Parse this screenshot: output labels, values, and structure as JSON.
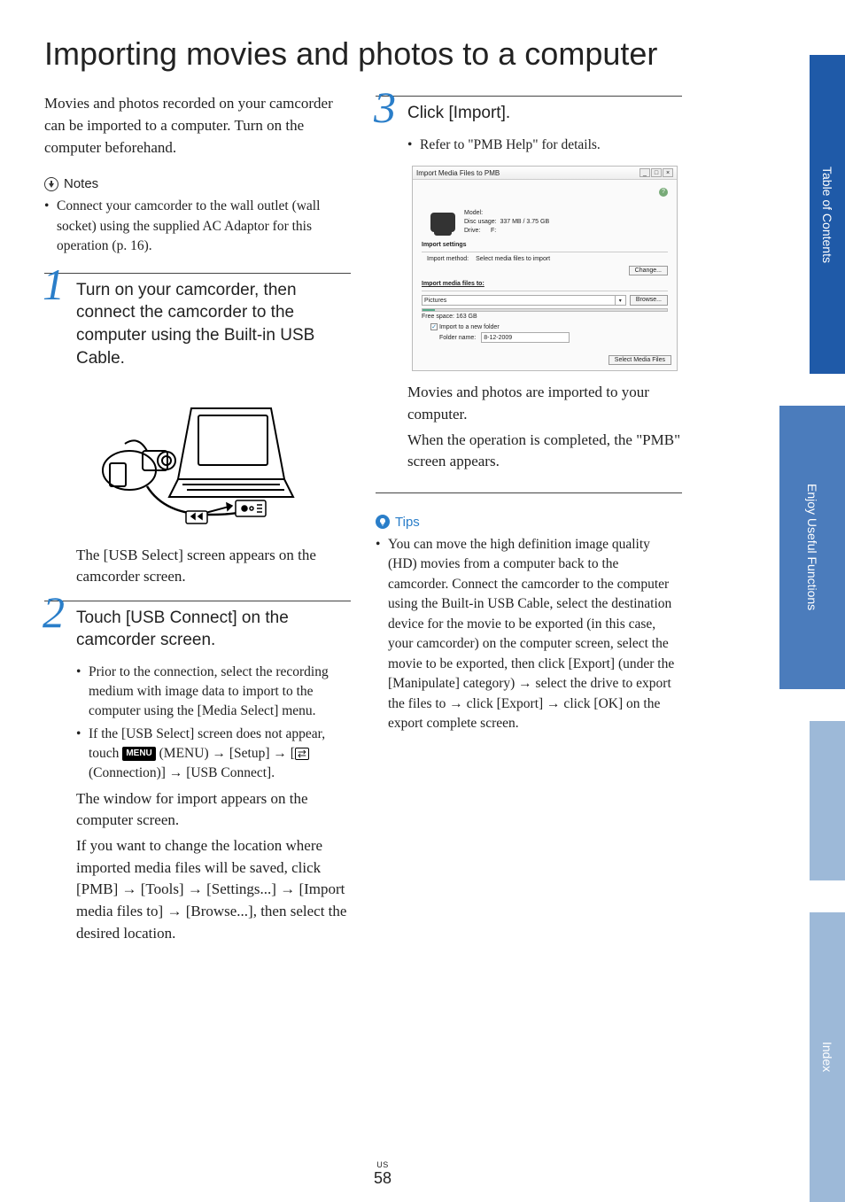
{
  "title": "Importing movies and photos to a computer",
  "intro": "Movies and photos recorded on your camcorder can be imported to a computer. Turn on the computer beforehand.",
  "notes": {
    "heading": "Notes",
    "items": [
      "Connect your camcorder to the wall outlet (wall socket) using the supplied AC Adaptor for this operation (p. 16)."
    ]
  },
  "steps": {
    "s1": {
      "num": "1",
      "title": "Turn on your camcorder, then connect the camcorder to the computer using the Built-in USB Cable.",
      "caption": "The [USB Select] screen appears on the camcorder screen."
    },
    "s2": {
      "num": "2",
      "title": "Touch [USB Connect] on the camcorder screen.",
      "bullets": [
        "Prior to the connection, select the recording medium with image data to import to the computer using the [Media Select] menu."
      ],
      "bullet2_pre": "If the [USB Select] screen does not appear, touch ",
      "menu_label": "MENU",
      "bullet2_mid": " (MENU) → [Setup] → [",
      "bullet2_post": " (Connection)] → [USB Connect].",
      "after1": "The window for import appears on the computer screen.",
      "after2": "If you want to change the location where imported media files will be saved, click [PMB] →  [Tools] → [Settings...] →  [Import media files to] →  [Browse...], then select the desired location."
    },
    "s3": {
      "num": "3",
      "title": "Click [Import].",
      "bullet": "Refer to \"PMB Help\" for details.",
      "after_a": "Movies and photos are imported to your computer.",
      "after_b": "When the operation is completed, the \"PMB\" screen appears."
    }
  },
  "dialog": {
    "title": "Import Media Files to PMB",
    "model_label": "Model:",
    "disc_label": "Disc usage:",
    "disc_value": "337 MB / 3.75 GB",
    "drive_label": "Drive:",
    "drive_value": "F:",
    "import_settings": "Import settings",
    "import_method_label": "Import method:",
    "import_method_value": "Select media files to import",
    "change_btn": "Change...",
    "import_to": "Import media files to:",
    "pictures": "Pictures",
    "browse_btn": "Browse...",
    "free_space": "Free space:   163 GB",
    "import_new_folder": "Import to a new folder",
    "folder_name_label": "Folder name:",
    "folder_name_value": "8-12-2009",
    "select_btn": "Select Media Files"
  },
  "tips": {
    "heading": "Tips",
    "items": [
      "You can move the high definition image quality (HD) movies from a computer back to the camcorder. Connect the camcorder to the computer using the Built-in USB Cable, select the destination device for the movie to be exported (in this case, your camcorder) on the computer screen, select the movie to be exported, then click [Export] (under the [Manipulate] category) → select the drive to export the files to → click [Export] → click [OK] on the export complete screen."
    ]
  },
  "side_tabs": {
    "toc": "Table of Contents",
    "enjoy": "Enjoy Useful Functions",
    "index": "Index"
  },
  "page": {
    "region": "US",
    "num": "58"
  }
}
